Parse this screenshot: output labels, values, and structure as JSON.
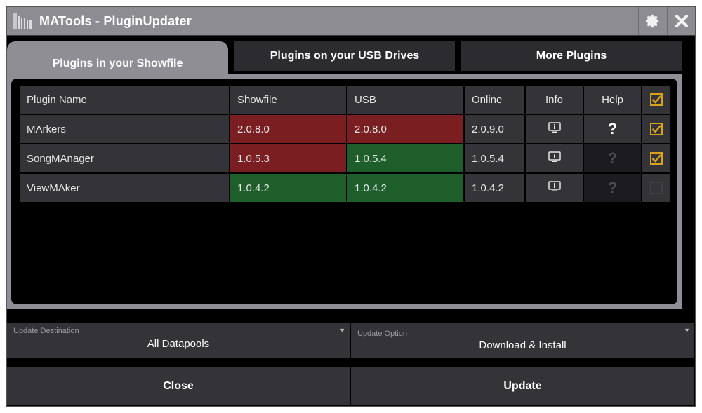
{
  "window": {
    "title": "MATools - PluginUpdater",
    "icons": {
      "app": "matools-logo-icon",
      "settings": "gear-icon",
      "close": "close-icon"
    }
  },
  "tabs": [
    {
      "label": "Plugins in your Showfile",
      "active": true
    },
    {
      "label": "Plugins on your USB Drives",
      "active": false
    },
    {
      "label": "More Plugins",
      "active": false
    }
  ],
  "table": {
    "headers": {
      "name": "Plugin Name",
      "showfile": "Showfile",
      "usb": "USB",
      "online": "Online",
      "info": "Info",
      "help": "Help",
      "select_all": true
    },
    "rows": [
      {
        "name": "MArkers",
        "showfile": "2.0.8.0",
        "showfile_status": "outdated",
        "usb": "2.0.8.0",
        "usb_status": "outdated",
        "online": "2.0.9.0",
        "help": "?",
        "help_enabled": true,
        "checked": true
      },
      {
        "name": "SongMAnager",
        "showfile": "1.0.5.3",
        "showfile_status": "outdated",
        "usb": "1.0.5.4",
        "usb_status": "current",
        "online": "1.0.5.4",
        "help": "?",
        "help_enabled": false,
        "checked": true
      },
      {
        "name": "ViewMAker",
        "showfile": "1.0.4.2",
        "showfile_status": "current",
        "usb": "1.0.4.2",
        "usb_status": "current",
        "online": "1.0.4.2",
        "help": "?",
        "help_enabled": false,
        "checked": false
      }
    ]
  },
  "update_destination": {
    "label": "Update Destination",
    "value": "All Datapools"
  },
  "update_option": {
    "label": "Update Option",
    "value": "Download & Install"
  },
  "buttons": {
    "close": "Close",
    "update": "Update"
  },
  "colors": {
    "outdated": "#7a1e22",
    "current": "#1d5e2a",
    "check": "#d9a21b",
    "title_bar": "#8c8c92"
  }
}
